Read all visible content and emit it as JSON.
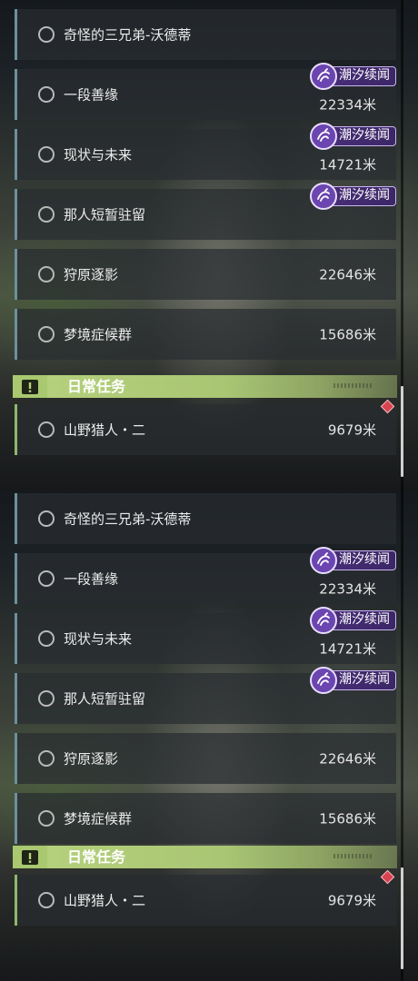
{
  "quests": [
    {
      "title": "奇怪的三兄弟-沃德蒂",
      "distance": "",
      "badge": ""
    },
    {
      "title": "一段善缘",
      "distance": "22334米",
      "badge": "潮汐续闻"
    },
    {
      "title": "现状与未来",
      "distance": "14721米",
      "badge": "潮汐续闻"
    },
    {
      "title": "那人短暂驻留",
      "distance": "",
      "badge": "潮汐续闻"
    },
    {
      "title": "狩原逐影",
      "distance": "22646米",
      "badge": ""
    },
    {
      "title": "梦境症候群",
      "distance": "15686米",
      "badge": ""
    }
  ],
  "daily": {
    "header": "日常任务",
    "items": [
      {
        "title": "山野猎人・二",
        "distance": "9679米"
      }
    ]
  },
  "colors": {
    "accent_blue": "#6f8f9c",
    "daily_green": "#b7d27e",
    "badge_purple": "#4a2f7a",
    "alert_red": "#d8434f"
  },
  "icons": {
    "quest_status": "circle-outline-icon",
    "badge": "tide-emblem-icon",
    "daily_header": "exclamation-box-icon",
    "alert": "red-diamond-icon"
  }
}
